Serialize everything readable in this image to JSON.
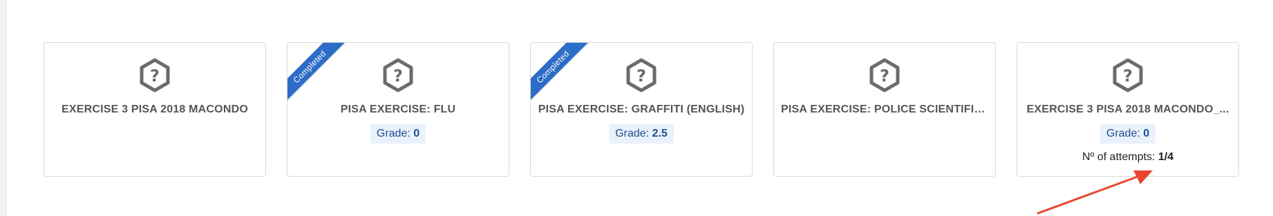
{
  "cards": [
    {
      "title": "EXERCISE 3 PISA 2018 MACONDO",
      "icon": "question-hexagon-icon",
      "ribbon": "",
      "grade_label": "",
      "grade_value": "",
      "attempts_label": "",
      "attempts_value": ""
    },
    {
      "title": "PISA EXERCISE: FLU",
      "icon": "question-hexagon-icon",
      "ribbon": "Completed",
      "grade_label": "Grade: ",
      "grade_value": "0",
      "attempts_label": "",
      "attempts_value": ""
    },
    {
      "title": "PISA EXERCISE: GRAFFITI (ENGLISH)",
      "icon": "question-hexagon-icon",
      "ribbon": "Completed",
      "grade_label": "Grade: ",
      "grade_value": "2.5",
      "attempts_label": "",
      "attempts_value": ""
    },
    {
      "title": "PISA EXERCISE: POLICE SCIENTIFIC...",
      "icon": "question-hexagon-icon",
      "ribbon": "",
      "grade_label": "",
      "grade_value": "",
      "attempts_label": "",
      "attempts_value": ""
    },
    {
      "title": "EXERCISE 3 PISA 2018 MACONDO_...",
      "icon": "question-hexagon-icon",
      "ribbon": "",
      "grade_label": "Grade: ",
      "grade_value": "0",
      "attempts_label": "Nº of attempts: ",
      "attempts_value": "1/4"
    }
  ],
  "colors": {
    "ribbon": "#2d6cc7",
    "grade_bg": "#e9f1fb",
    "grade_text": "#1f4e8c",
    "icon": "#6b6b6b",
    "annotation_arrow": "#e8472f"
  }
}
